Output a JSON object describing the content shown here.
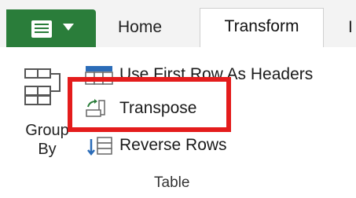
{
  "tabs": {
    "home": "Home",
    "transform": "Transform",
    "next_partial": "I"
  },
  "ribbon": {
    "group_by_label": "Group\nBy",
    "commands": {
      "use_first_row": "Use First Row As Headers",
      "transpose": "Transpose",
      "reverse_rows": "Reverse Rows"
    },
    "group_name": "Table"
  },
  "colors": {
    "file_button": "#2a7d3a",
    "highlight_box": "#e41c1c",
    "icon_blue": "#2b6cb8",
    "icon_green": "#2a7d3a"
  }
}
